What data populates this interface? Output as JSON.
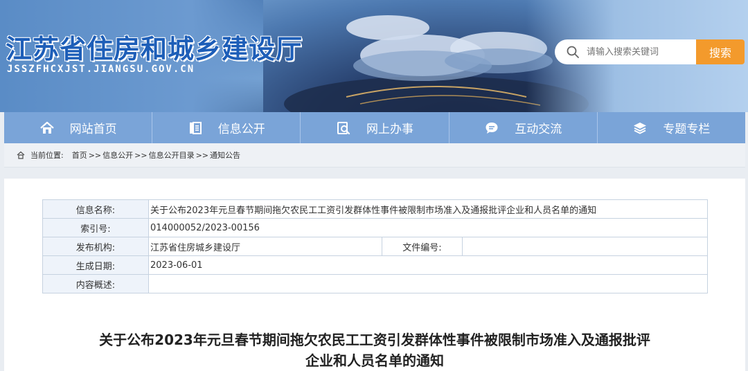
{
  "header": {
    "site_title": "江苏省住房和城乡建设厅",
    "site_url": "JSSZFHCXJST.JIANGSU.GOV.CN",
    "search_placeholder": "请输入搜索关键词",
    "search_button": "搜索"
  },
  "nav": {
    "items": [
      {
        "label": "网站首页",
        "icon": "home-icon"
      },
      {
        "label": "信息公开",
        "icon": "document-icon"
      },
      {
        "label": "网上办事",
        "icon": "search-doc-icon"
      },
      {
        "label": "互动交流",
        "icon": "chat-icon"
      },
      {
        "label": "专题专栏",
        "icon": "layers-icon"
      }
    ]
  },
  "breadcrumb": {
    "prefix": "当前位置:",
    "items": [
      "首页",
      "信息公开",
      "信息公开目录",
      "通知公告"
    ],
    "separator": ">>"
  },
  "info": {
    "name_label": "信息名称:",
    "name_value": "关于公布2023年元旦春节期间拖欠农民工工资引发群体性事件被限制市场准入及通报批评企业和人员名单的通知",
    "index_label": "索引号:",
    "index_value": "014000052/2023-00156",
    "publisher_label": "发布机构:",
    "publisher_value": "江苏省住房城乡建设厅",
    "fileno_label": "文件编号:",
    "fileno_value": "",
    "date_label": "生成日期:",
    "date_value": "2023-06-01",
    "summary_label": "内容概述:",
    "summary_value": ""
  },
  "document": {
    "title_line1": "关于公布2023年元旦春节期间拖欠农民工工资引发群体性事件被限制市场准入及通报批评",
    "title_line2": "企业和人员名单的通知"
  },
  "colors": {
    "nav_bg": "#7aa4d8",
    "search_button": "#f39a2c",
    "title_blue": "#1d5eb8"
  }
}
